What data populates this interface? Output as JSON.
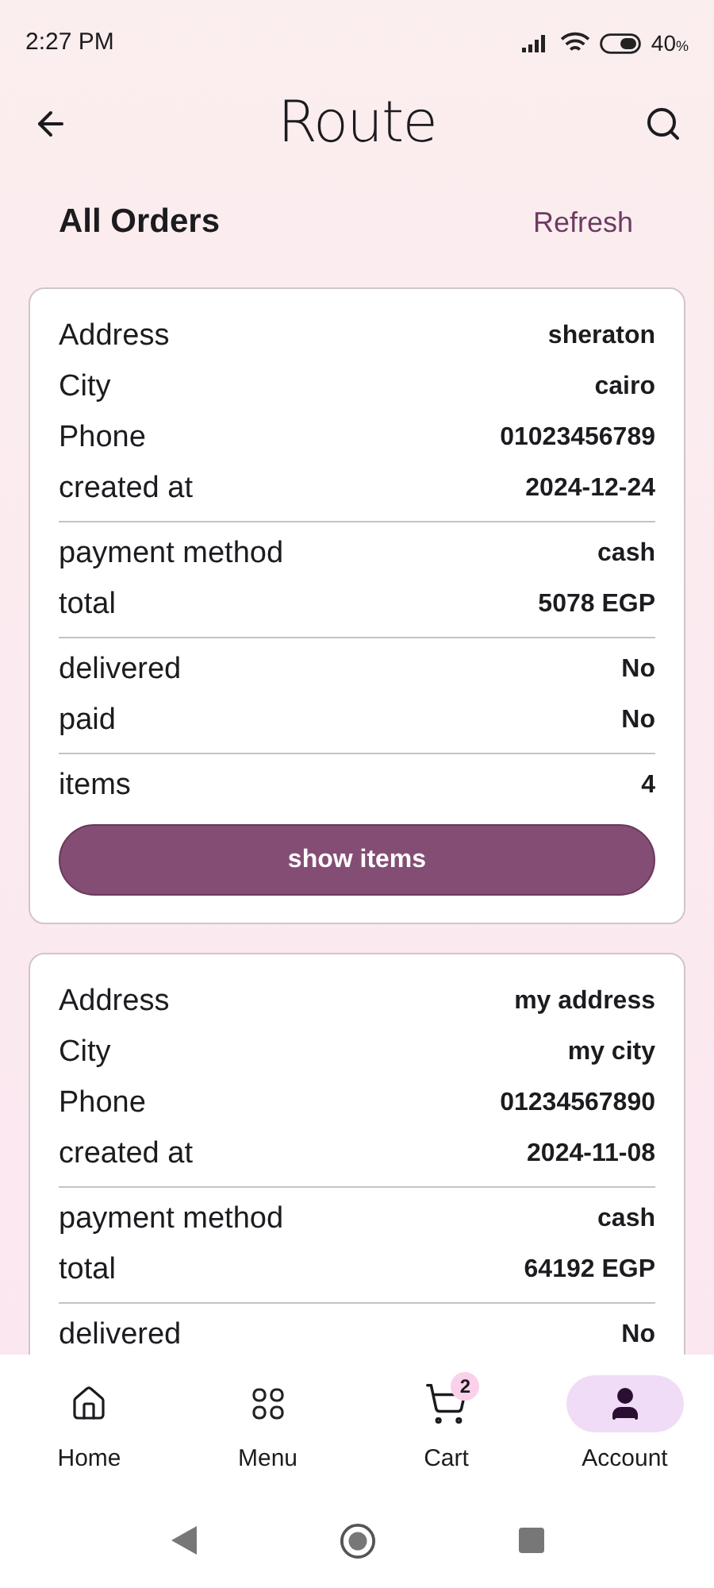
{
  "status_bar": {
    "time": "2:27 PM",
    "battery": "40",
    "battery_unit": "%"
  },
  "header": {
    "logo": "Route"
  },
  "title": "All Orders",
  "refresh": "Refresh",
  "orders": [
    {
      "groups": [
        [
          {
            "label": "Address",
            "value": "sheraton"
          },
          {
            "label": "City",
            "value": "cairo"
          },
          {
            "label": "Phone",
            "value": "01023456789"
          },
          {
            "label": "created at",
            "value": "2024-12-24"
          }
        ],
        [
          {
            "label": "payment method",
            "value": "cash"
          },
          {
            "label": "total",
            "value": "5078 EGP"
          }
        ],
        [
          {
            "label": "delivered",
            "value": "No"
          },
          {
            "label": "paid",
            "value": "No"
          }
        ],
        [
          {
            "label": "items",
            "value": "4"
          }
        ]
      ],
      "button": "show items"
    },
    {
      "groups": [
        [
          {
            "label": "Address",
            "value": "my address"
          },
          {
            "label": "City",
            "value": "my city"
          },
          {
            "label": "Phone",
            "value": "01234567890"
          },
          {
            "label": "created at",
            "value": "2024-11-08"
          }
        ],
        [
          {
            "label": "payment method",
            "value": "cash"
          },
          {
            "label": "total",
            "value": "64192 EGP"
          }
        ],
        [
          {
            "label": "delivered",
            "value": "No"
          }
        ]
      ]
    }
  ],
  "bottom_nav": [
    {
      "kind": "home",
      "label": "Home",
      "selected": false
    },
    {
      "kind": "menu",
      "label": "Menu",
      "selected": false
    },
    {
      "kind": "cart",
      "label": "Cart",
      "selected": false,
      "badge": "2"
    },
    {
      "kind": "account",
      "label": "Account",
      "selected": true
    }
  ]
}
